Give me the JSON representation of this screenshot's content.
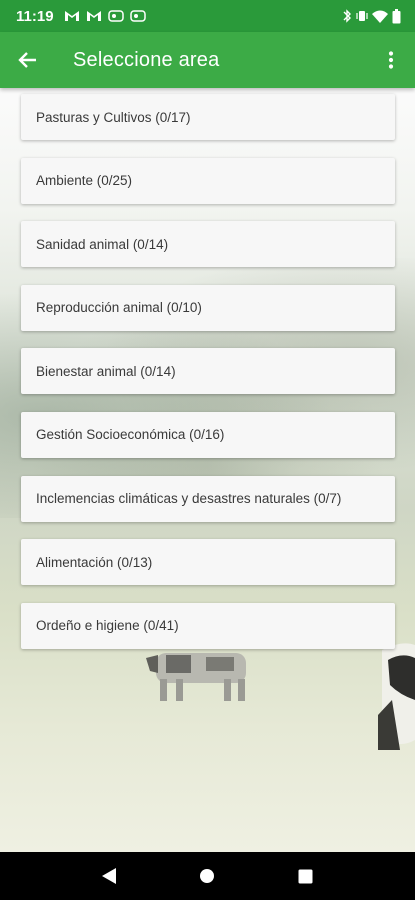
{
  "status_bar": {
    "time": "11:19",
    "icons_left": [
      "gmail-icon",
      "gmail-icon",
      "app-notification-icon",
      "app-notification-icon"
    ],
    "icons_right": [
      "bluetooth-icon",
      "vibrate-icon",
      "wifi-icon",
      "battery-icon"
    ]
  },
  "app_bar": {
    "title": "Seleccione area",
    "back_icon": "arrow-back-icon",
    "menu_icon": "more-vert-icon",
    "color": "#3cab46"
  },
  "areas": [
    {
      "label": "Pasturas y Cultivos (0/17)"
    },
    {
      "label": "Ambiente (0/25)"
    },
    {
      "label": "Sanidad animal (0/14)"
    },
    {
      "label": "Reproducción animal (0/10)"
    },
    {
      "label": "Bienestar animal (0/14)"
    },
    {
      "label": "Gestión Socioeconómica (0/16)"
    },
    {
      "label": "Inclemencias climáticas y desastres naturales (0/7)"
    },
    {
      "label": "Alimentación  (0/13)"
    },
    {
      "label": "Ordeño e higiene   (0/41)"
    }
  ],
  "nav_bar": {
    "buttons": [
      "back-triangle-icon",
      "home-circle-icon",
      "recents-square-icon"
    ]
  }
}
